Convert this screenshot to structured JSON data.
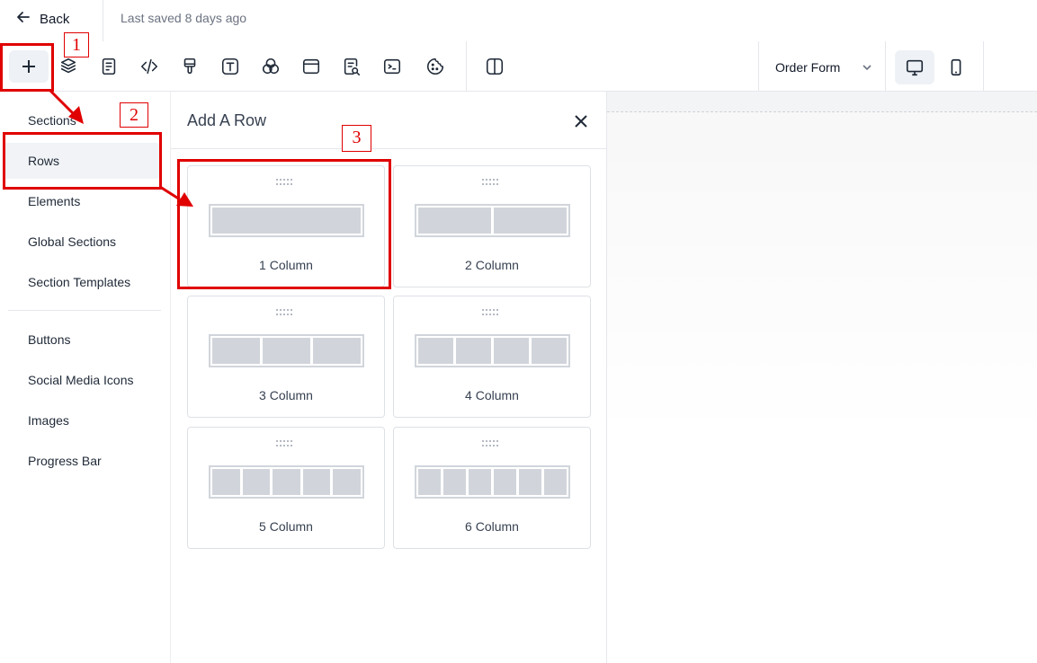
{
  "header": {
    "back_label": "Back",
    "saved_text": "Last saved 8 days ago"
  },
  "toolbar": {
    "icons": [
      "plus-icon",
      "layers-icon",
      "page-icon",
      "code-icon",
      "brush-icon",
      "text-icon",
      "color-circles-icon",
      "browser-icon",
      "search-document-icon",
      "terminal-icon",
      "cookie-icon",
      "split-view-icon",
      "desktop-icon",
      "mobile-icon"
    ],
    "form_select": "Order Form",
    "active_device": "desktop"
  },
  "sidebar": {
    "items": [
      {
        "label": "Sections"
      },
      {
        "label": "Rows"
      },
      {
        "label": "Elements"
      },
      {
        "label": "Global Sections"
      },
      {
        "label": "Section Templates"
      },
      {
        "label": "Buttons"
      },
      {
        "label": "Social Media Icons"
      },
      {
        "label": "Images"
      },
      {
        "label": "Progress Bar"
      }
    ],
    "active": "Rows"
  },
  "panel": {
    "title": "Add A Row",
    "rows": [
      {
        "label": "1 Column",
        "columns": 1
      },
      {
        "label": "2 Column",
        "columns": 2
      },
      {
        "label": "3 Column",
        "columns": 3
      },
      {
        "label": "4 Column",
        "columns": 4
      },
      {
        "label": "5 Column",
        "columns": 5
      },
      {
        "label": "6 Column",
        "columns": 6
      }
    ]
  },
  "annotations": {
    "color": "#e00000",
    "labels": [
      "1",
      "2",
      "3"
    ]
  }
}
